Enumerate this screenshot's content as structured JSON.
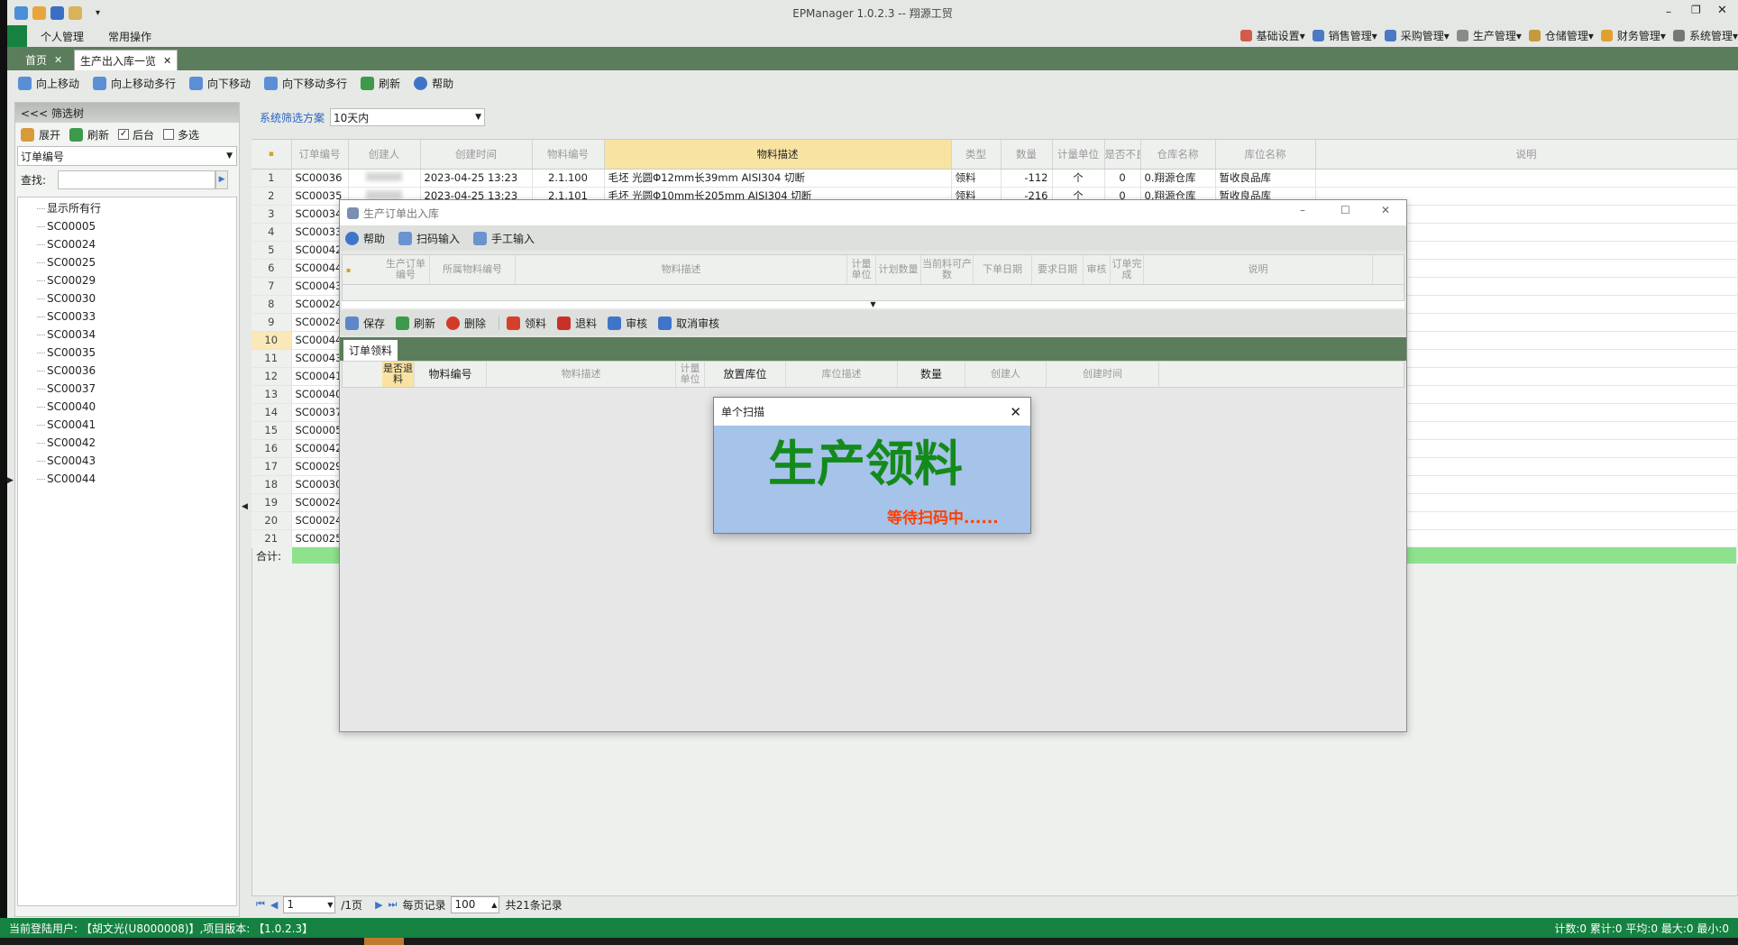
{
  "window": {
    "title": "EPManager 1.0.2.3 -- 翔源工贸"
  },
  "menu": {
    "left": [
      "个人管理",
      "常用操作"
    ],
    "right": [
      "基础设置",
      "销售管理",
      "采购管理",
      "生产管理",
      "仓储管理",
      "财务管理",
      "系统管理"
    ]
  },
  "tabs": [
    {
      "label": "首页"
    },
    {
      "label": "生产出入库一览"
    }
  ],
  "toolbar": [
    "向上移动",
    "向上移动多行",
    "向下移动",
    "向下移动多行",
    "刷新",
    "帮助"
  ],
  "filter": {
    "header": "<<< 筛选树",
    "expand": "展开",
    "refresh": "刷新",
    "backend": "后台",
    "multi": "多选",
    "field": "订单编号",
    "search_label": "查找:",
    "search_value": ""
  },
  "tree_items": [
    "显示所有行",
    "SC00005",
    "SC00024",
    "SC00025",
    "SC00029",
    "SC00030",
    "SC00033",
    "SC00034",
    "SC00035",
    "SC00036",
    "SC00037",
    "SC00040",
    "SC00041",
    "SC00042",
    "SC00043",
    "SC00044"
  ],
  "scheme": {
    "label": "系统筛选方案",
    "value": "10天内"
  },
  "grid": {
    "columns": [
      "订单编号",
      "创建人",
      "创建时间",
      "物料编号",
      "物料描述",
      "类型",
      "数量",
      "计量单位",
      "是否不良",
      "仓库名称",
      "库位名称",
      "说明"
    ],
    "rows": [
      {
        "n": "1",
        "order": "SC00036",
        "time": "2023-04-25 13:23",
        "code": "2.1.100",
        "desc": "毛坯 光圆Φ12mm长39mm AISI304 切断",
        "type": "领料",
        "qty": "-112",
        "unit": "个",
        "bad": "0",
        "wh": "0.翔源仓库",
        "loc": "暂收良品库"
      },
      {
        "n": "2",
        "order": "SC00035",
        "time": "2023-04-25 13:23",
        "code": "2.1.101",
        "desc": "毛坯 光圆Φ10mm长205mm AISI304 切断",
        "type": "领料",
        "qty": "-216",
        "unit": "个",
        "bad": "0",
        "wh": "0.翔源仓库",
        "loc": "暂收良品库"
      },
      {
        "n": "3",
        "order": "SC00034"
      },
      {
        "n": "4",
        "order": "SC00033"
      },
      {
        "n": "5",
        "order": "SC00042"
      },
      {
        "n": "6",
        "order": "SC00044"
      },
      {
        "n": "7",
        "order": "SC00043"
      },
      {
        "n": "8",
        "order": "SC00024"
      },
      {
        "n": "9",
        "order": "SC00024"
      },
      {
        "n": "10",
        "order": "SC00044"
      },
      {
        "n": "11",
        "order": "SC00043"
      },
      {
        "n": "12",
        "order": "SC00041"
      },
      {
        "n": "13",
        "order": "SC00040"
      },
      {
        "n": "14",
        "order": "SC00037"
      },
      {
        "n": "15",
        "order": "SC00005"
      },
      {
        "n": "16",
        "order": "SC00042"
      },
      {
        "n": "17",
        "order": "SC00029"
      },
      {
        "n": "18",
        "order": "SC00030"
      },
      {
        "n": "19",
        "order": "SC00024"
      },
      {
        "n": "20",
        "order": "SC00024"
      },
      {
        "n": "21",
        "order": "SC00025"
      }
    ],
    "total_label": "合计:",
    "selected_row": 10
  },
  "pager": {
    "page": "1",
    "of": "/1页",
    "per_label": "每页记录",
    "per_value": "100",
    "total": "共21条记录"
  },
  "status": {
    "left": "当前登陆用户: 【胡文光(U8000008)】,项目版本: 【1.0.2.3】",
    "right": "计数:0 累计:0 平均:0 最大:0 最小:0"
  },
  "dialog": {
    "title": "生产订单出入库",
    "toolbar": [
      "帮助",
      "扫码输入",
      "手工输入"
    ],
    "top_columns": [
      "生产订单编号",
      "所属物料编号",
      "物料描述",
      "计量单位",
      "计划数量",
      "当前料可产数",
      "下单日期",
      "要求日期",
      "审核",
      "订单完成",
      "说明"
    ],
    "actions": [
      "保存",
      "刷新",
      "删除",
      "领料",
      "退料",
      "审核",
      "取消审核"
    ],
    "tab": "订单领料",
    "bottom_columns": [
      "是否退料",
      "物料编号",
      "物料描述",
      "计量单位",
      "放置库位",
      "库位描述",
      "数量",
      "创建人",
      "创建时间"
    ]
  },
  "scan": {
    "title": "单个扫描",
    "main": "生产领料",
    "sub": "等待扫码中......"
  },
  "colors": {
    "accent": "#5b7d5b",
    "status": "#158241",
    "highlight": "#f9e3a3",
    "scan_bg": "#a6c3e9",
    "scan_main": "#158a1c",
    "scan_sub": "#ff4000"
  }
}
